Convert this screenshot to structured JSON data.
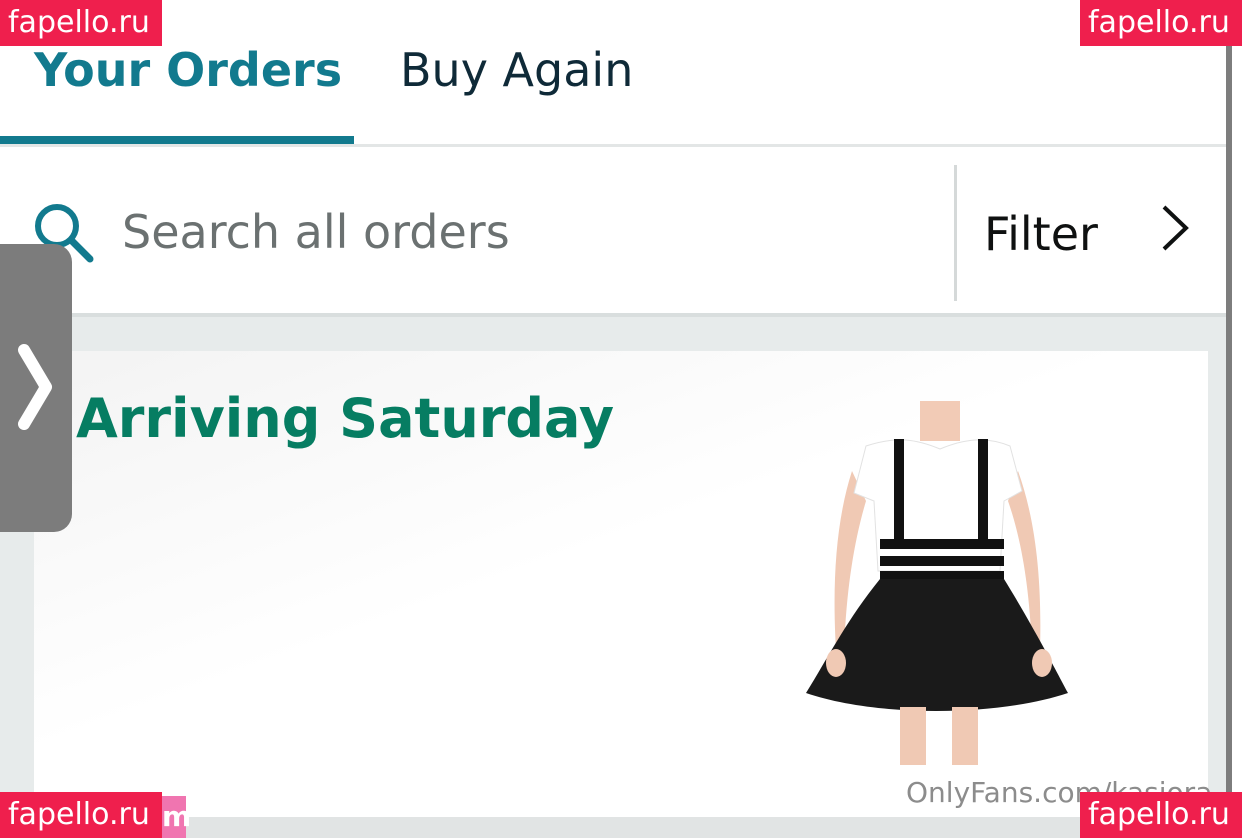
{
  "tabs": {
    "your_orders": "Your Orders",
    "buy_again": "Buy Again",
    "active": "Your Orders"
  },
  "search": {
    "placeholder": "Search all orders",
    "icon": "search-icon"
  },
  "filter": {
    "label": "Filter",
    "icon": "chevron-right-icon"
  },
  "order": {
    "status": "Arriving Saturday",
    "product_image": "black suspender skater skirt with white t-shirt"
  },
  "watermarks": {
    "top_left": "fapello.ru",
    "top_right": "fapello.ru",
    "bottom_left": "fapello.ru",
    "bottom_left_suffix": "m",
    "bottom_right": "fapello.ru",
    "onlyfans": "OnlyFans.com/kasiora"
  },
  "colors": {
    "accent_teal": "#127a8e",
    "arriving_green": "#067d62",
    "tab_text": "#0f2a38",
    "watermark_red": "#ef1f4d"
  }
}
